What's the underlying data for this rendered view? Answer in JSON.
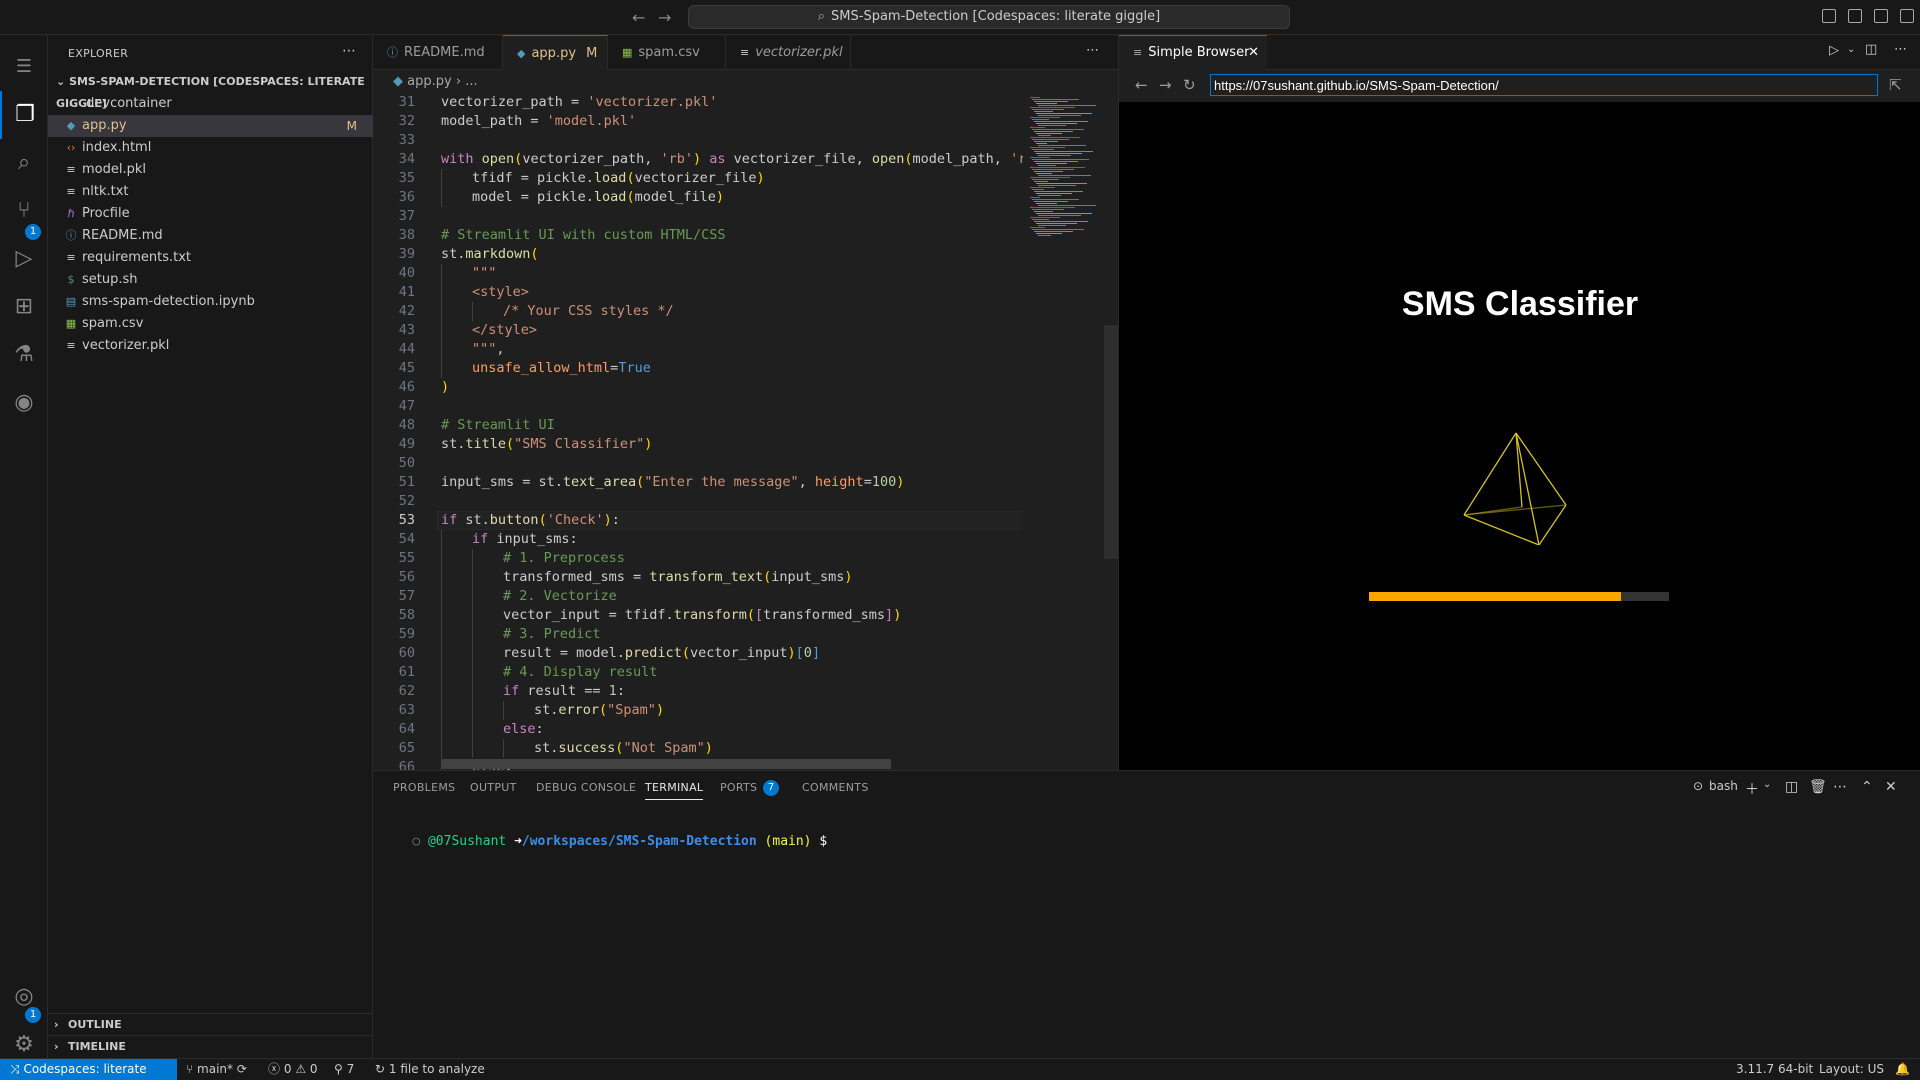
{
  "titlebar": {
    "command_center": "SMS-Spam-Detection [Codespaces: literate giggle]"
  },
  "activity": {
    "source_control_badge": "1",
    "accounts_badge": "1"
  },
  "explorer": {
    "header": "EXPLORER",
    "root": "SMS-SPAM-DETECTION [CODESPACES: LITERATE GIGGLE]",
    "items": [
      {
        "label": ".devcontainer",
        "type": "folder",
        "icon": "chevron-right-icon"
      },
      {
        "label": "app.py",
        "type": "python",
        "icon": "python-file-icon",
        "badge": "M",
        "selected": true
      },
      {
        "label": "index.html",
        "type": "html",
        "icon": "html-file-icon"
      },
      {
        "label": "model.pkl",
        "type": "file",
        "icon": "file-lines-icon"
      },
      {
        "label": "nltk.txt",
        "type": "file",
        "icon": "file-lines-icon"
      },
      {
        "label": "Procfile",
        "type": "procfile",
        "icon": "heroku-icon"
      },
      {
        "label": "README.md",
        "type": "info",
        "icon": "info-icon"
      },
      {
        "label": "requirements.txt",
        "type": "file",
        "icon": "file-lines-icon"
      },
      {
        "label": "setup.sh",
        "type": "shell",
        "icon": "dollar-icon"
      },
      {
        "label": "sms-spam-detection.ipynb",
        "type": "notebook",
        "icon": "notebook-icon"
      },
      {
        "label": "spam.csv",
        "type": "csv",
        "icon": "table-icon"
      },
      {
        "label": "vectorizer.pkl",
        "type": "file",
        "icon": "file-lines-icon"
      }
    ],
    "outline": "OUTLINE",
    "timeline": "TIMELINE"
  },
  "editor": {
    "tabs": [
      {
        "label": "README.md",
        "icon": "info-icon"
      },
      {
        "label": "app.py",
        "icon": "python-file-icon",
        "badge": "M",
        "active": true
      },
      {
        "label": "spam.csv",
        "icon": "table-icon"
      },
      {
        "label": "vectorizer.pkl",
        "icon": "file-lines-icon"
      }
    ],
    "breadcrumb": {
      "file": "app.py",
      "rest": "..."
    },
    "current_line": 53,
    "lines": [
      {
        "n": "31",
        "indent": 0,
        "html": "vectorizer_path = <span class=\"s\">'vectorizer.pkl'</span>"
      },
      {
        "n": "32",
        "indent": 0,
        "html": "model_path = <span class=\"s\">'model.pkl'</span>"
      },
      {
        "n": "33",
        "indent": 0,
        "html": ""
      },
      {
        "n": "34",
        "indent": 0,
        "html": "<span class=\"k\">with</span> <span class=\"f\">open</span><span class=\"p\">(</span>vectorizer_path, <span class=\"s\">'rb'</span><span class=\"p\">)</span> <span class=\"k\">as</span> vectorizer_file, <span class=\"f\">open</span><span class=\"p\">(</span>model_path, <span class=\"s\">'rb'</span><span class=\"p\">)</span>"
      },
      {
        "n": "35",
        "indent": 1,
        "html": "tfidf = pickle.<span class=\"f\">load</span><span class=\"p\">(</span>vectorizer_file<span class=\"p\">)</span>"
      },
      {
        "n": "36",
        "indent": 1,
        "html": "model = pickle.<span class=\"f\">load</span><span class=\"p\">(</span>model_file<span class=\"p\">)</span>"
      },
      {
        "n": "37",
        "indent": 0,
        "html": ""
      },
      {
        "n": "38",
        "indent": 0,
        "html": "<span class=\"c\"># Streamlit UI with custom HTML/CSS</span>"
      },
      {
        "n": "39",
        "indent": 0,
        "html": "st.<span class=\"f\">markdown</span><span class=\"p\">(</span>"
      },
      {
        "n": "40",
        "indent": 1,
        "html": "<span class=\"s\">\"\"\"</span>"
      },
      {
        "n": "41",
        "indent": 1,
        "html": "<span class=\"s\">&lt;style&gt;</span>"
      },
      {
        "n": "42",
        "indent": 2,
        "html": "<span class=\"s\">/* Your CSS styles */</span>"
      },
      {
        "n": "43",
        "indent": 1,
        "html": "<span class=\"s\">&lt;/style&gt;</span>"
      },
      {
        "n": "44",
        "indent": 1,
        "html": "<span class=\"s\">\"\"\"</span>,"
      },
      {
        "n": "45",
        "indent": 1,
        "html": "<span class=\"pa\">unsafe_allow_html</span>=<span class=\"kb\">True</span>"
      },
      {
        "n": "46",
        "indent": 0,
        "html": "<span class=\"p\">)</span>"
      },
      {
        "n": "47",
        "indent": 0,
        "html": ""
      },
      {
        "n": "48",
        "indent": 0,
        "html": "<span class=\"c\"># Streamlit UI</span>"
      },
      {
        "n": "49",
        "indent": 0,
        "html": "st.<span class=\"f\">title</span><span class=\"p\">(</span><span class=\"s\">\"SMS Classifier\"</span><span class=\"p\">)</span>"
      },
      {
        "n": "50",
        "indent": 0,
        "html": ""
      },
      {
        "n": "51",
        "indent": 0,
        "html": "input_sms = st.<span class=\"f\">text_area</span><span class=\"p\">(</span><span class=\"s\">\"Enter the message\"</span>, <span class=\"pa\">height</span>=<span class=\"n\">100</span><span class=\"p\">)</span>"
      },
      {
        "n": "52",
        "indent": 0,
        "html": ""
      },
      {
        "n": "53",
        "indent": 0,
        "html": "<span class=\"k\">if</span> st.<span class=\"f\">button</span><span class=\"p\">(</span><span class=\"s\">'Check'</span><span class=\"p\">)</span>:"
      },
      {
        "n": "54",
        "indent": 1,
        "html": "<span class=\"k\">if</span> input_sms:"
      },
      {
        "n": "55",
        "indent": 2,
        "html": "<span class=\"c\"># 1. Preprocess</span>"
      },
      {
        "n": "56",
        "indent": 2,
        "html": "transformed_sms = <span class=\"f\">transform_text</span><span class=\"p\">(</span>input_sms<span class=\"p\">)</span>"
      },
      {
        "n": "57",
        "indent": 2,
        "html": "<span class=\"c\"># 2. Vectorize</span>"
      },
      {
        "n": "58",
        "indent": 2,
        "html": "vector_input = tfidf.<span class=\"f\">transform</span><span class=\"p\">(</span><span class=\"k\">[</span>transformed_sms<span class=\"k\">]</span><span class=\"p\">)</span>"
      },
      {
        "n": "59",
        "indent": 2,
        "html": "<span class=\"c\"># 3. Predict</span>"
      },
      {
        "n": "60",
        "indent": 2,
        "html": "result = model.<span class=\"f\">predict</span><span class=\"p\">(</span>vector_input<span class=\"p\">)</span><span class=\"kb\">[</span><span class=\"n\">0</span><span class=\"kb\">]</span>"
      },
      {
        "n": "61",
        "indent": 2,
        "html": "<span class=\"c\"># 4. Display result</span>"
      },
      {
        "n": "62",
        "indent": 2,
        "html": "<span class=\"k\">if</span> result == <span class=\"n\">1</span>:"
      },
      {
        "n": "63",
        "indent": 3,
        "html": "st.<span class=\"f\">error</span><span class=\"p\">(</span><span class=\"s\">\"Spam\"</span><span class=\"p\">)</span>"
      },
      {
        "n": "64",
        "indent": 2,
        "html": "<span class=\"k\">else</span>:"
      },
      {
        "n": "65",
        "indent": 3,
        "html": "st.<span class=\"f\">success</span><span class=\"p\">(</span><span class=\"s\">\"Not Spam\"</span><span class=\"p\">)</span>"
      },
      {
        "n": "66",
        "indent": 1,
        "html": "<span class=\"k\">else</span>:"
      }
    ]
  },
  "browser": {
    "tab_label": "Simple Browser",
    "url": "https://07sushant.github.io/SMS-Spam-Detection/",
    "page_title": "SMS Classifier",
    "loading_progress": 0.84
  },
  "panel": {
    "tabs": [
      "PROBLEMS",
      "OUTPUT",
      "DEBUG CONSOLE",
      "TERMINAL",
      "PORTS",
      "COMMENTS"
    ],
    "active_tab": "TERMINAL",
    "ports_badge": "7",
    "shell_label": "bash",
    "terminal": {
      "user": "@07Sushant",
      "arrow": "➜",
      "path": "/workspaces/SMS-Spam-Detection",
      "branch": "(main)",
      "prompt": "$"
    }
  },
  "statusbar": {
    "remote": "Codespaces: literate giggle",
    "branch": "main*",
    "errors": "0",
    "warnings": "0",
    "ports": "7",
    "analyze": "1 file to analyze",
    "python": "3.11.7 64-bit",
    "layout": "Layout: US"
  },
  "colors": {
    "accent": "#0078d4",
    "loading": "#ffa500",
    "modified": "#e2c08d",
    "pyramid": "#d4c21c"
  }
}
